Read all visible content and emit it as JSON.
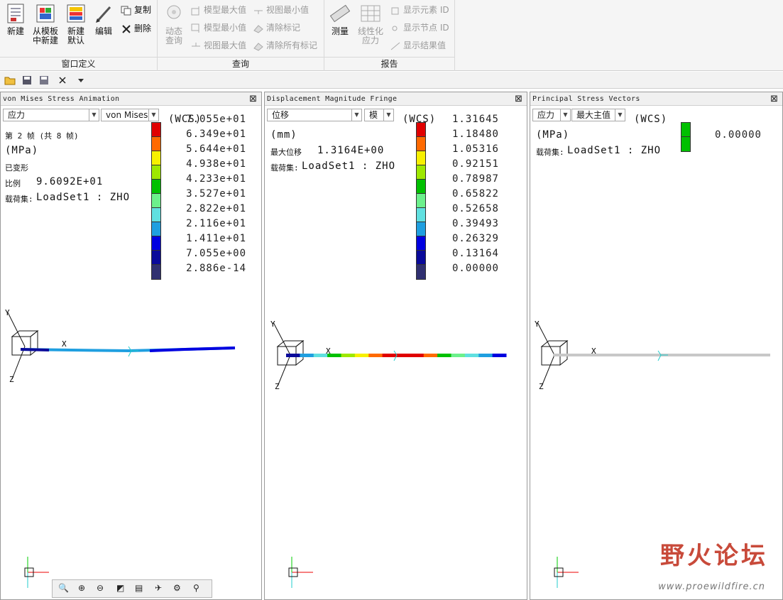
{
  "ribbon": {
    "groups": {
      "window_def": "窗口定义",
      "query": "查询",
      "report": "报告"
    },
    "new_btn": "新建",
    "from_template_1": "从模板",
    "from_template_2": "中新建",
    "new_default_1": "新建",
    "new_default_2": "默认",
    "edit_btn": "编辑",
    "copy_btn": "复制",
    "delete_btn": "删除",
    "dynamic_query_1": "动态",
    "dynamic_query_2": "查询",
    "model_max": "模型最大值",
    "model_min": "模型最小值",
    "view_max": "视图最大值",
    "view_min": "视图最小值",
    "clear_mark": "清除标记",
    "clear_all_marks": "清除所有标记",
    "measure_btn": "测量",
    "linearize_1": "线性化",
    "linearize_2": "应力",
    "show_element_id": "显示元素 ID",
    "show_node_id": "显示节点 ID",
    "show_result_value": "显示结果值"
  },
  "panels": [
    {
      "title": "von Mises Stress Animation",
      "select1": "应力",
      "select2": "von Mises",
      "wcs": "(WCS)",
      "lines": [
        "第 2 帧 (共 8 帧)",
        "(MPa)",
        "已变形",
        "比例",
        "9.6092E+01",
        "载荷集:",
        "LoadSet1  :  ZHO"
      ],
      "legend_values": [
        "7.055e+01",
        "6.349e+01",
        "5.644e+01",
        "4.938e+01",
        "4.233e+01",
        "3.527e+01",
        "2.822e+01",
        "2.116e+01",
        "1.411e+01",
        "7.055e+00",
        "2.886e-14"
      ]
    },
    {
      "title": "Displacement Magnitude Fringe",
      "select1": "位移",
      "select2": "模",
      "wcs": "(WCS)",
      "lines": [
        "(mm)",
        "最大位移",
        "1.3164E+00",
        "载荷集:",
        "LoadSet1  :  ZHO"
      ],
      "legend_values": [
        "1.31645",
        "1.18480",
        "1.05316",
        "0.92151",
        "0.78987",
        "0.65822",
        "0.52658",
        "0.39493",
        "0.26329",
        "0.13164",
        "0.00000"
      ]
    },
    {
      "title": "Principal Stress Vectors",
      "select1": "应力",
      "select2": "最大主值",
      "wcs": "(WCS)",
      "lines": [
        "(MPa)",
        "载荷集:",
        "LoadSet1  :  ZHO"
      ],
      "legend_values": [
        "0.00000"
      ]
    }
  ],
  "legend_colors": [
    "#e00000",
    "#ff6a00",
    "#f7f000",
    "#9ee800",
    "#00c000",
    "#6cf08c",
    "#60e0e0",
    "#1f9fe0",
    "#0000e0",
    "#0a0a9a",
    "#303070"
  ],
  "axis": {
    "x": "X",
    "y": "Y",
    "z": "Z"
  },
  "watermark": {
    "name": "野火论坛",
    "url": "www.proewildfire.cn"
  }
}
